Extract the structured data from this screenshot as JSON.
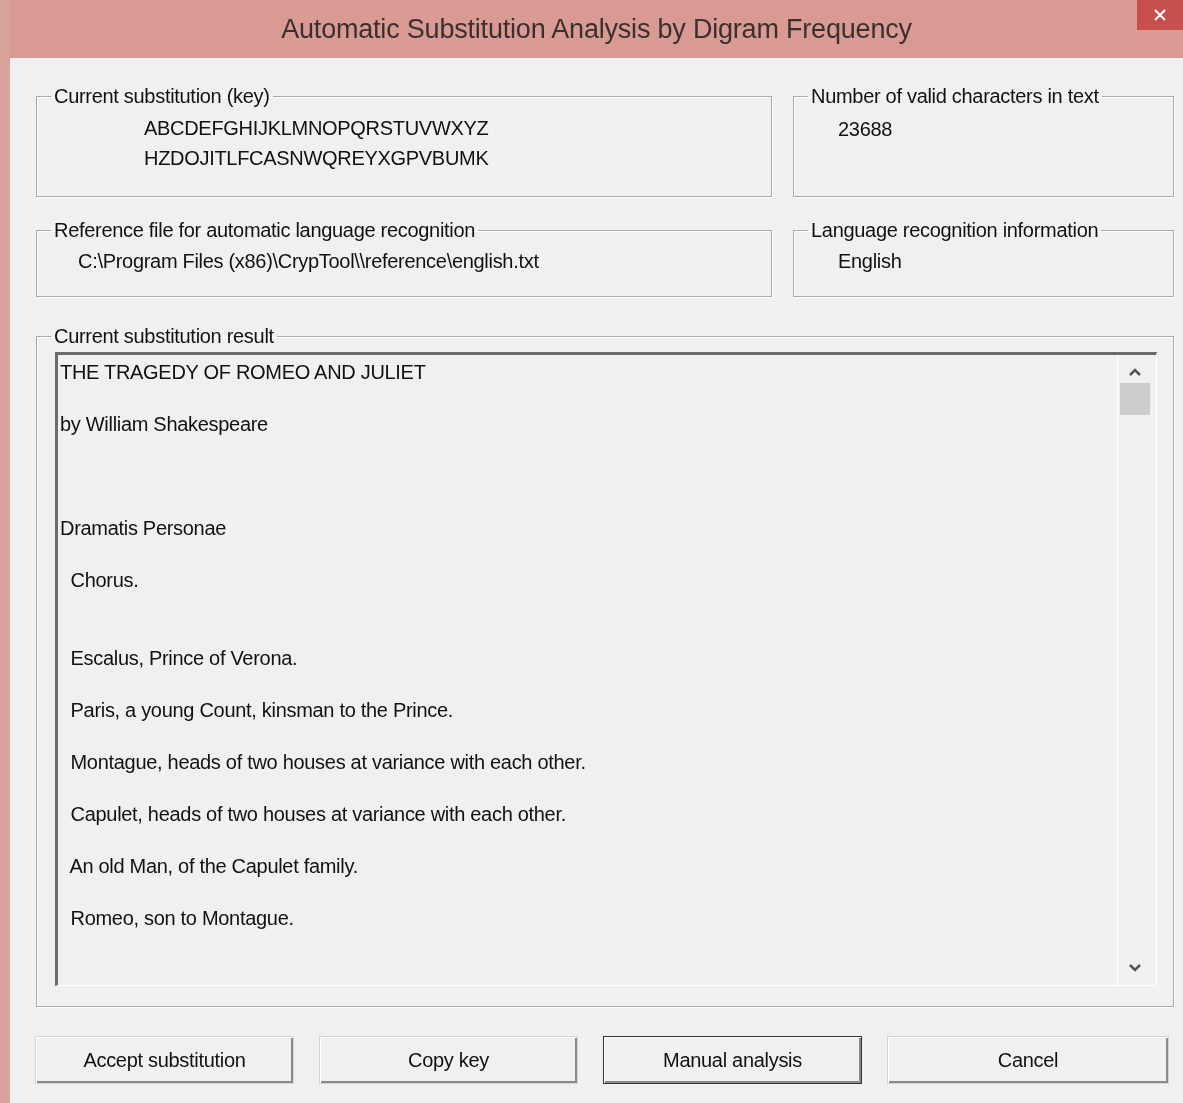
{
  "window": {
    "title": "Automatic Substitution Analysis by Digram Frequency"
  },
  "key_group": {
    "label": "Current substitution (key)",
    "plain_alphabet": "ABCDEFGHIJKLMNOPQRSTUVWXYZ",
    "cipher_alphabet": "HZDOJITLFCASNWQREYXGPVBUMK"
  },
  "character_count": {
    "label": "Number of valid characters in text",
    "value": "23688"
  },
  "reference_file": {
    "label": "Reference file for automatic language recognition",
    "value": "C:\\Program Files (x86)\\CrypTool\\\\reference\\english.txt"
  },
  "language": {
    "label": "Language recognition information",
    "value": "English"
  },
  "result": {
    "label": "Current substitution result",
    "value": "THE TRAGEDY OF ROMEO AND JULIET\n\nby William Shakespeare\n\n\n\nDramatis Personae\n\n  Chorus.\n\n\n  Escalus, Prince of Verona.\n\n  Paris, a young Count, kinsman to the Prince.\n\n  Montague, heads of two houses at variance with each other.\n\n  Capulet, heads of two houses at variance with each other.\n\n  An old Man, of the Capulet family.\n\n  Romeo, son to Montague."
  },
  "buttons": [
    {
      "label": "Accept substitution",
      "default": false
    },
    {
      "label": "Copy key",
      "default": false
    },
    {
      "label": "Manual analysis",
      "default": true
    },
    {
      "label": "Cancel",
      "default": false
    }
  ]
}
